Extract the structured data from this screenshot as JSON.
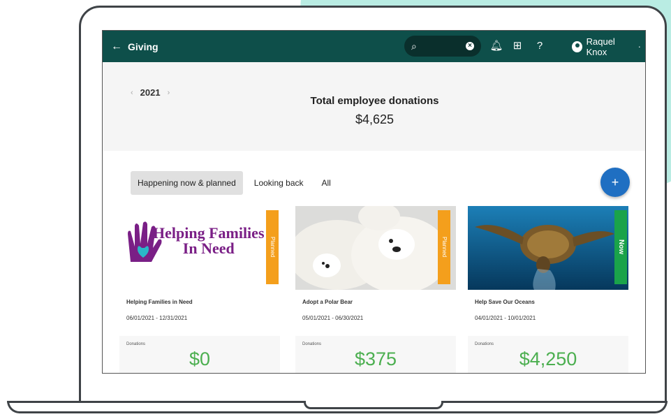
{
  "header": {
    "back_label": "Giving",
    "user_name": "Raquel Knox"
  },
  "summary": {
    "year": "2021",
    "title": "Total employee donations",
    "total": "$4,625"
  },
  "tabs": [
    {
      "label": "Happening now & planned",
      "active": true
    },
    {
      "label": "Looking back",
      "active": false
    },
    {
      "label": "All",
      "active": false
    }
  ],
  "fab_label": "+",
  "cards": [
    {
      "image_title_line1": "Helping Families",
      "image_title_line2": "In Need",
      "status": "Planned",
      "status_color": "#f49f1c",
      "name": "Helping Families in Need",
      "dates": "06/01/2021 - 12/31/2021",
      "donations_label": "Donations",
      "donations": "$0"
    },
    {
      "status": "Planned",
      "status_color": "#f49f1c",
      "name": "Adopt a Polar Bear",
      "dates": "05/01/2021 - 06/30/2021",
      "donations_label": "Donations",
      "donations": "$375"
    },
    {
      "status": "Now",
      "status_color": "#1aa34a",
      "name": "Help Save Our Oceans",
      "dates": "04/01/2021 - 10/01/2021",
      "donations_label": "Donations",
      "donations": "$4,250"
    }
  ],
  "icons": {
    "back": "arrow-left-icon",
    "search": "search-icon",
    "clear": "clear-icon",
    "notifications": "bell-icon",
    "feedback": "feedback-icon",
    "help": "help-icon",
    "account": "account-circle-icon"
  },
  "colors": {
    "topbar": "#0e4f4a",
    "accent": "#1f6fc2",
    "donation_green": "#4caf50"
  }
}
